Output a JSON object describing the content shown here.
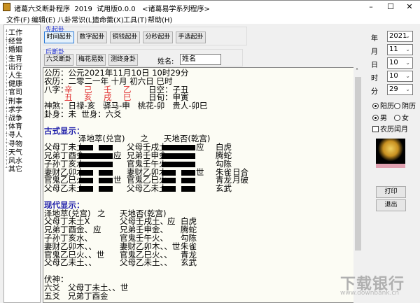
{
  "window": {
    "title": "诸葛六爻断卦程序  2019  试用版0.0.0   <诸葛易学系列程序>",
    "minimize": "–",
    "maximize": "☐",
    "close": "✕"
  },
  "menu": [
    "文件(F)",
    "编辑(E)",
    "八卦常识(L)",
    "遗命薷(X)",
    "工具(T)",
    "帮助(H)"
  ],
  "tree": [
    "工作",
    "经营",
    "婚姻",
    "生育",
    "出行",
    "人生",
    "健康",
    "官司",
    "刑事",
    "求学",
    "战争",
    "体育",
    "寻人",
    "寻物",
    "天气",
    "风水",
    "其它"
  ],
  "qigua": {
    "label": "先起卦",
    "buttons": [
      "时间起卦",
      "数字起卦",
      "铜钱起卦",
      "分秒起卦",
      "手选起卦"
    ]
  },
  "duangua": {
    "label": "后断卦",
    "buttons": [
      "六爻断卦",
      "梅花易数",
      "测终身卦"
    ]
  },
  "name": {
    "label": "姓名:",
    "value": "姓名"
  },
  "info": {
    "gongli": "公历：公元2021年11月10日 10时29分",
    "nongli": "农历：二零二一年 十月 初六日 巳时",
    "bazi_label": "八字：",
    "bazi_top": [
      "辛",
      "己",
      "壬",
      "乙"
    ],
    "bazi_bottom": [
      "丑",
      "亥",
      "戌",
      "巳"
    ],
    "rikong": "日空：子丑",
    "rixun": "日旬：甲寅",
    "shensha": "神煞：日禄-亥   驿马-申   桃花-卯   贵人-卯巳",
    "guashen": "卦身：未  世身：六爻"
  },
  "ancient": {
    "heading": "古式显示：",
    "title": "泽地萃(兑宫)      之      天地否(乾宫)",
    "rows": [
      {
        "a": "父母丁未土",
        "ay": "yin",
        "am": "",
        "b": "父母壬戌土",
        "by": "yang",
        "bm": "应",
        "god": "白虎",
        "ext": ""
      },
      {
        "a": "兄弟丁酉金",
        "ay": "yang",
        "am": "应",
        "b": "兄弟壬申金",
        "by": "yang",
        "bm": "",
        "god": "腾蛇",
        "ext": ""
      },
      {
        "a": "子孙丁亥水",
        "ay": "yang",
        "am": "",
        "b": "官鬼壬午火",
        "by": "yang",
        "bm": "",
        "god": "勾陈",
        "ext": ""
      },
      {
        "a": "妻财乙卯木",
        "ay": "yin",
        "am": "",
        "b": "妻财乙卯木",
        "by": "yin",
        "bm": "世",
        "god": "朱雀",
        "ext": "日合"
      },
      {
        "a": "官鬼乙巳火",
        "ay": "yin",
        "am": "世",
        "b": "官鬼乙巳火",
        "by": "yin",
        "bm": "",
        "god": "青龙",
        "ext": "月破"
      },
      {
        "a": "父母乙未土",
        "ay": "yin",
        "am": "",
        "b": "父母乙未土",
        "by": "yin",
        "bm": "",
        "god": "玄武",
        "ext": ""
      }
    ]
  },
  "modern": {
    "heading": "现代显示：",
    "title_a": "泽地萃(兑宫)",
    "zhi": "之",
    "title_b": "天地否(乾宫)",
    "rows": [
      {
        "a": "父母丁未土X",
        "am": "",
        "b": "父母壬戌土、",
        "bm": "应",
        "god": "白虎"
      },
      {
        "a": "兄弟丁酉金、",
        "am": "应",
        "b": "兄弟壬申金、",
        "bm": "",
        "god": "腾蛇"
      },
      {
        "a": "子孙丁亥水、",
        "am": "",
        "b": "官鬼壬午火、",
        "bm": "",
        "god": "勾陈"
      },
      {
        "a": "妻财乙卯木、、",
        "am": "",
        "b": "妻财乙卯木、、世",
        "bm": "",
        "god": "朱雀"
      },
      {
        "a": "官鬼乙巳火、、世",
        "am": "",
        "b": "官鬼乙巳火、、",
        "bm": "",
        "god": "青龙"
      },
      {
        "a": "父母乙未土、、",
        "am": "",
        "b": "父母乙未土、、",
        "bm": "",
        "god": "玄武"
      }
    ]
  },
  "fushen": {
    "heading": "伏神：",
    "line1": "六爻   父母丁未土、、世",
    "line2": "五爻   兄弟丁酉金"
  },
  "date": {
    "fields": [
      {
        "label": "年",
        "value": "2021"
      },
      {
        "label": "月",
        "value": "11"
      },
      {
        "label": "日",
        "value": "10"
      },
      {
        "label": "时",
        "value": "10"
      },
      {
        "label": "分",
        "value": "29"
      }
    ],
    "calendar": {
      "options": [
        "阳历",
        "阴历"
      ],
      "selected": "阳历"
    },
    "gender": {
      "options": [
        "男",
        "女"
      ],
      "selected": "男"
    },
    "leap_month": {
      "label": "农历闰月",
      "checked": false
    }
  },
  "actions": {
    "print": "打印",
    "exit": "退出"
  },
  "watermark": {
    "text": "下载银行",
    "url": "www.downbank.cn"
  },
  "colors": {
    "bazi": "#e03030",
    "heading": "#1a1aa8",
    "text_bg": "#fcfcf4"
  }
}
